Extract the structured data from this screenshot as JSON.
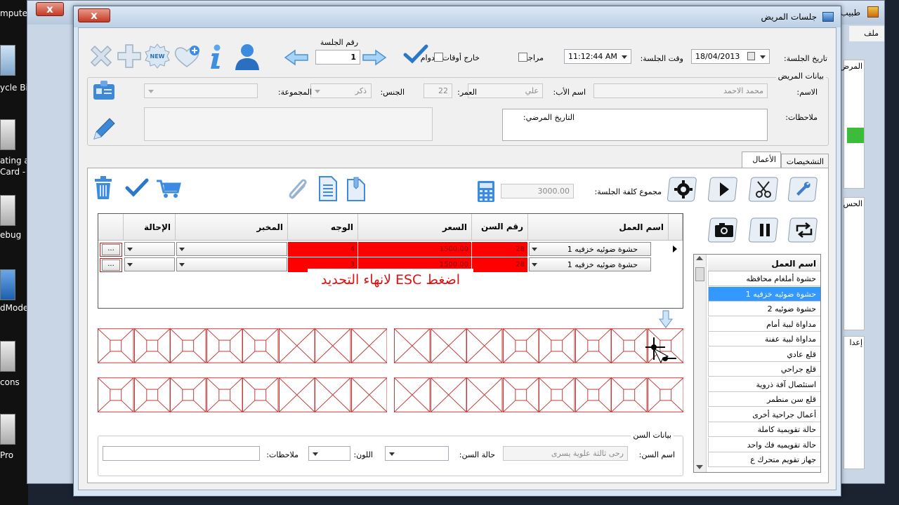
{
  "desktop": {
    "labels": [
      "mpute",
      "ycle Bi",
      "ating a",
      "Card -",
      "ebug",
      "dMode",
      "cons",
      "Pro"
    ]
  },
  "back_window": {
    "title": "طبيب",
    "menu_file": "ملف",
    "close_label": "x",
    "side_labels": [
      "المرض",
      "الحس",
      "إعدا"
    ]
  },
  "window": {
    "title": "جلسات المريض",
    "close_label": "x"
  },
  "session": {
    "date_label": "تاريخ الجلسة:",
    "date_value": "18/04/2013",
    "time_label": "وقت الجلسة:",
    "time_value": "11:12:44 AM",
    "review_label": "مراجعة",
    "outside_hours_label": "خارج أوقات الدوام",
    "number_label": "رقم الجلسة",
    "number_value": "1",
    "new_badge": "NEW"
  },
  "patient": {
    "section_title": "بيانات المريض",
    "name_label": "الاسم:",
    "name_value": "محمد الاحمد",
    "father_label": "اسم الأب:",
    "father_value": "علي",
    "age_label": "العمر:",
    "age_value": "22",
    "gender_label": "الجنس:",
    "gender_value": "ذكر",
    "group_label": "المجموعة:",
    "group_value": "",
    "notes_label": "ملاحظات:",
    "notes_value": "",
    "history_label": "التاريخ المرضي:",
    "history_value": ""
  },
  "tabs": [
    {
      "label": "التشخيصات",
      "active": false
    },
    {
      "label": "الأعمال",
      "active": true
    }
  ],
  "works": {
    "cost_label": "مجموع كلفة الجلسة:",
    "cost_value": "3000.00",
    "columns": [
      "اسم العمل",
      "رقم السن",
      "السعر",
      "الوجه",
      "المخبر",
      "الإحالة"
    ],
    "rows": [
      {
        "work": "حشوة ضوئيه خزفيه 1",
        "tooth": "28",
        "price": "1500.00",
        "face": "4",
        "lab": "",
        "referral": "",
        "more": "..."
      },
      {
        "work": "حشوة ضوئيه خزفيه 1",
        "tooth": "28",
        "price": "1500.00",
        "face": "3",
        "lab": "",
        "referral": "",
        "more": "..."
      }
    ],
    "esc_message": "اضغط ESC لانهاء التحديد"
  },
  "works_list": {
    "header": "اسم العمل",
    "items": [
      {
        "label": "حشوة أملغام محافظه",
        "selected": false
      },
      {
        "label": "حشوة ضوئيه خزفيه 1",
        "selected": true
      },
      {
        "label": "حشوة ضوئيه 2",
        "selected": false
      },
      {
        "label": "مداواة لبية أمام",
        "selected": false
      },
      {
        "label": "مداواة لبية عفنة",
        "selected": false
      },
      {
        "label": "قلع عادي",
        "selected": false
      },
      {
        "label": "قلع جراحي",
        "selected": false
      },
      {
        "label": "استئصال آفة ذروية",
        "selected": false
      },
      {
        "label": "قلع سن منطمر",
        "selected": false
      },
      {
        "label": "أعمال جراحية أخرى",
        "selected": false
      },
      {
        "label": "حالة تقويمية كاملة",
        "selected": false
      },
      {
        "label": "حالة تقويميه فك واحد",
        "selected": false
      },
      {
        "label": "جهاز تقويم متحرك ع",
        "selected": false
      }
    ]
  },
  "tooth": {
    "section_title": "بيانات السن",
    "name_label": "اسم السن:",
    "name_value": "رحى ثالثة علوية يسرى",
    "state_label": "حالة السن:",
    "color_label": "اللون:",
    "notes_label": "ملاحظات:"
  },
  "colors": {
    "selection": "#3399ff",
    "highlight_row": "#ff0000",
    "tooth_grid": "#c23a3a",
    "esc_text": "#e01010"
  }
}
